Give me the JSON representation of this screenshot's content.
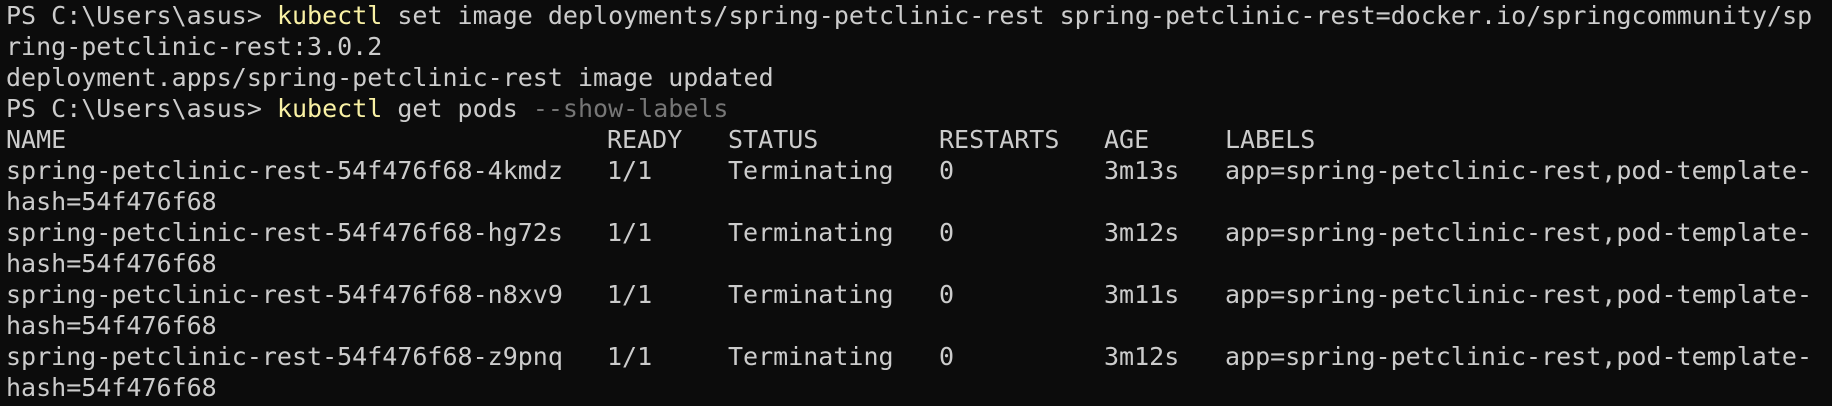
{
  "terminal": {
    "prompt": "PS C:\\Users\\asus> ",
    "cmd1": {
      "program": "kubectl",
      "args_line1": " set image deployments/spring-petclinic-rest spring-petclinic-rest=docker.io/springcommunity/sp",
      "args_line2": "ring-petclinic-rest:3.0.2"
    },
    "output1": "deployment.apps/spring-petclinic-rest image updated",
    "cmd2": {
      "program": "kubectl",
      "args": " get pods ",
      "flag": "--show-labels"
    },
    "table": {
      "headers": {
        "name": "NAME",
        "ready": "READY",
        "status": "STATUS",
        "restarts": "RESTARTS",
        "age": "AGE",
        "labels": "LABELS"
      },
      "rows": [
        {
          "name": "spring-petclinic-rest-54f476f68-4kmdz",
          "ready": "1/1",
          "status": "Terminating",
          "restarts": "0",
          "age": "3m13s",
          "labels": "app=spring-petclinic-rest,pod-template-",
          "labels_cont": "hash=54f476f68"
        },
        {
          "name": "spring-petclinic-rest-54f476f68-hg72s",
          "ready": "1/1",
          "status": "Terminating",
          "restarts": "0",
          "age": "3m12s",
          "labels": "app=spring-petclinic-rest,pod-template-",
          "labels_cont": "hash=54f476f68"
        },
        {
          "name": "spring-petclinic-rest-54f476f68-n8xv9",
          "ready": "1/1",
          "status": "Terminating",
          "restarts": "0",
          "age": "3m11s",
          "labels": "app=spring-petclinic-rest,pod-template-",
          "labels_cont": "hash=54f476f68"
        },
        {
          "name": "spring-petclinic-rest-54f476f68-z9pnq",
          "ready": "1/1",
          "status": "Terminating",
          "restarts": "0",
          "age": "3m12s",
          "labels": "app=spring-petclinic-rest,pod-template-",
          "labels_cont": "hash=54f476f68"
        }
      ]
    },
    "colors": {
      "background": "#0c0c0c",
      "text": "#cccccc",
      "command": "#f9f1a5",
      "parameter": "#767676"
    }
  }
}
